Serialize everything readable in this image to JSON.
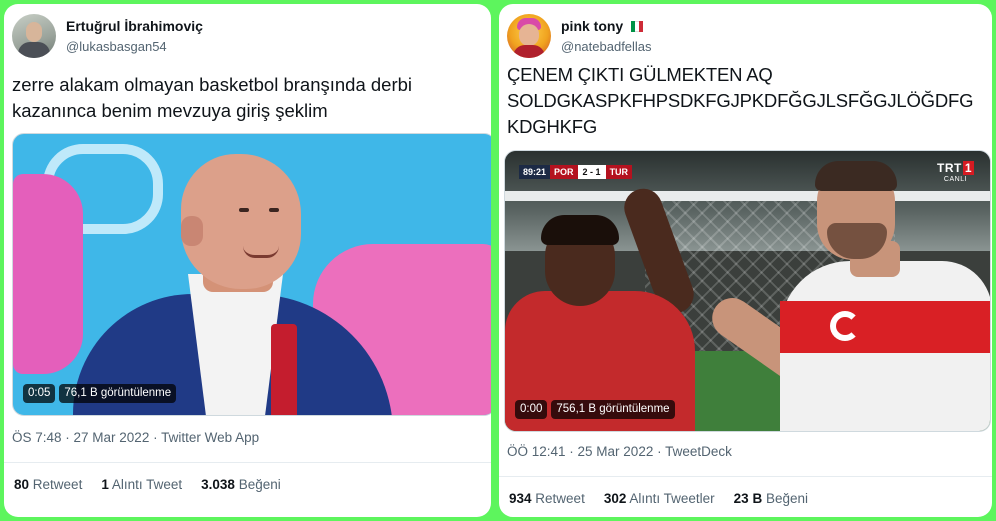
{
  "colors": {
    "background": "#5df55d",
    "card": "#ffffff",
    "text_primary": "#0f1419",
    "text_secondary": "#536471"
  },
  "tweets": [
    {
      "display_name": "Ertuğrul İbrahimoviç",
      "handle": "@lukasbasgan54",
      "text": "zerre alakam olmayan basketbol branşında derbi kazanınca benim mevzuya giriş şeklim",
      "video": {
        "duration": "0:05",
        "views": "76,1 B görüntülenme"
      },
      "meta": "ÖS 7:48 · 27 Mar 2022 · Twitter Web App",
      "stats": [
        {
          "count": "80",
          "label": "Retweet"
        },
        {
          "count": "1",
          "label": "Alıntı Tweet"
        },
        {
          "count": "3.038",
          "label": "Beğeni"
        }
      ]
    },
    {
      "display_name": "pink tony",
      "flag_icon": "italy-flag-icon",
      "handle": "@natebadfellas",
      "text": "ÇENEM ÇIKTI GÜLMEKTEN AQ SOLDGKASPKFHPSDKFGJPKDFĞGJLSFĞGJLÖĞDFG KDGHKFG",
      "video": {
        "duration": "0:00",
        "views": "756,1 B görüntülenme",
        "scorebug": {
          "time": "89:21",
          "home": "POR",
          "score": "2 - 1",
          "away": "TUR"
        },
        "broadcaster": {
          "logo": "TRT",
          "logo_num": "1",
          "live": "CANLI"
        }
      },
      "meta": "ÖÖ 12:41 · 25 Mar 2022 · TweetDeck",
      "stats": [
        {
          "count": "934",
          "label": "Retweet"
        },
        {
          "count": "302",
          "label": "Alıntı Tweetler"
        },
        {
          "count": "23 B",
          "label": "Beğeni"
        }
      ]
    }
  ]
}
